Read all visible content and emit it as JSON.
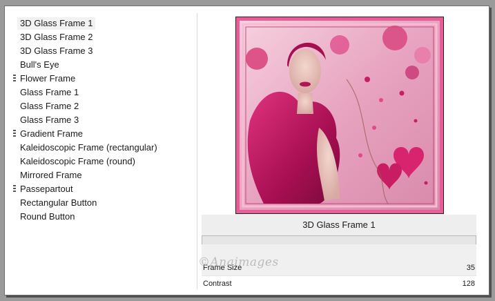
{
  "frames_list": {
    "items": [
      {
        "label": "3D Glass Frame 1",
        "selected": true,
        "has_grip": false
      },
      {
        "label": "3D Glass Frame 2",
        "selected": false,
        "has_grip": false
      },
      {
        "label": "3D Glass Frame 3",
        "selected": false,
        "has_grip": false
      },
      {
        "label": "Bull's Eye",
        "selected": false,
        "has_grip": false
      },
      {
        "label": "Flower Frame",
        "selected": false,
        "has_grip": true
      },
      {
        "label": "Glass Frame 1",
        "selected": false,
        "has_grip": false
      },
      {
        "label": "Glass Frame 2",
        "selected": false,
        "has_grip": false
      },
      {
        "label": "Glass Frame 3",
        "selected": false,
        "has_grip": false
      },
      {
        "label": "Gradient Frame",
        "selected": false,
        "has_grip": true
      },
      {
        "label": "Kaleidoscopic Frame (rectangular)",
        "selected": false,
        "has_grip": false
      },
      {
        "label": "Kaleidoscopic Frame (round)",
        "selected": false,
        "has_grip": false
      },
      {
        "label": "Mirrored Frame",
        "selected": false,
        "has_grip": false
      },
      {
        "label": "Passepartout",
        "selected": false,
        "has_grip": true
      },
      {
        "label": "Rectangular Button",
        "selected": false,
        "has_grip": false
      },
      {
        "label": "Round Button",
        "selected": false,
        "has_grip": false
      }
    ]
  },
  "preview": {
    "caption": "3D Glass Frame 1",
    "watermark": "©Anaimages"
  },
  "params": {
    "frame_size": {
      "label": "Frame Size",
      "value": "35"
    },
    "contrast": {
      "label": "Contrast",
      "value": "128"
    }
  },
  "colors": {
    "frame_pink": "#e85c98",
    "frame_light": "#f7bcd2",
    "dress_magenta": "#b5125a",
    "heart": "#d8246e"
  }
}
